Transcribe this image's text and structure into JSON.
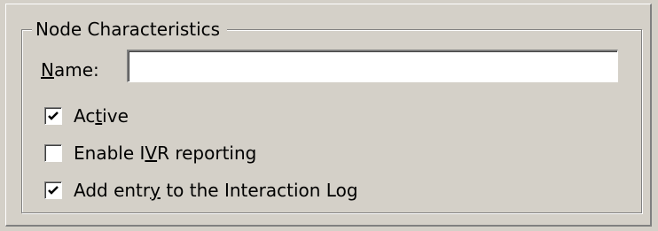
{
  "group": {
    "title": "Node Characteristics"
  },
  "name_field": {
    "label_mnemonic": "N",
    "label_rest": "ame:",
    "value": ""
  },
  "options": [
    {
      "before": "Ac",
      "mnemonic": "t",
      "after": "ive",
      "checked": true
    },
    {
      "before": "Enable I",
      "mnemonic": "V",
      "after": "R reporting",
      "checked": false
    },
    {
      "before": "Add entr",
      "mnemonic": "y",
      "after": " to the Interaction Log",
      "checked": true
    }
  ]
}
